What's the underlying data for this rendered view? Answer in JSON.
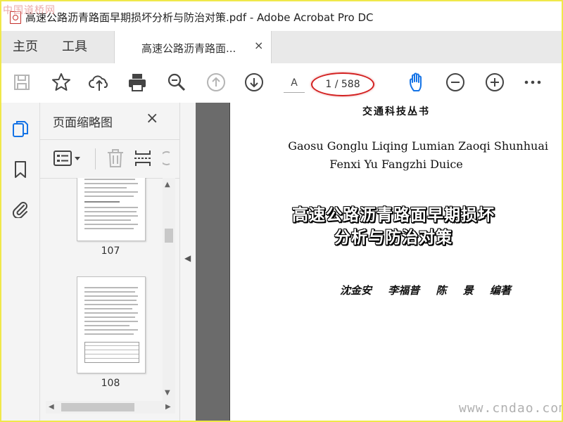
{
  "window": {
    "title": "高速公路沥青路面早期损坏分析与防治对策.pdf - Adobe Acrobat Pro DC",
    "watermark_top_left": "中国道桥网"
  },
  "tabs": {
    "home": "主页",
    "tools": "工具",
    "document": "高速公路沥青路面...",
    "close": "×"
  },
  "toolbar": {
    "page_letter": "A",
    "page_counter": "1 / 588",
    "icons": [
      "save-icon",
      "bookmark-star-icon",
      "upload-cloud-icon",
      "print-icon",
      "zoom-search-icon",
      "prev-page-icon",
      "next-page-icon",
      "hand-tool-icon",
      "zoom-out-icon",
      "zoom-in-icon",
      "more-icon"
    ]
  },
  "rail": {
    "icons": [
      "page-thumbnails-icon",
      "bookmarks-icon",
      "attachments-icon"
    ]
  },
  "thumb_panel": {
    "title": "页面缩略图",
    "close": "×",
    "pages": [
      {
        "label": "107"
      },
      {
        "label": "108"
      }
    ]
  },
  "document": {
    "series": "交通科技丛书",
    "pinyin_line1": "Gaosu Gonglu Liqing Lumian Zaoqi Shunhuai",
    "pinyin_line2": "Fenxi Yu Fangzhi Duice",
    "title_line1": "高速公路沥青路面早期损坏",
    "title_line2": "分析与防治对策",
    "authors": "沈金安 李福普 陈 景 编著"
  },
  "watermark_bottom_right": "www.cndao.com",
  "colors": {
    "accent_blue": "#1473e6",
    "counter_highlight": "#d32020",
    "outer_border": "#f0e84a"
  }
}
